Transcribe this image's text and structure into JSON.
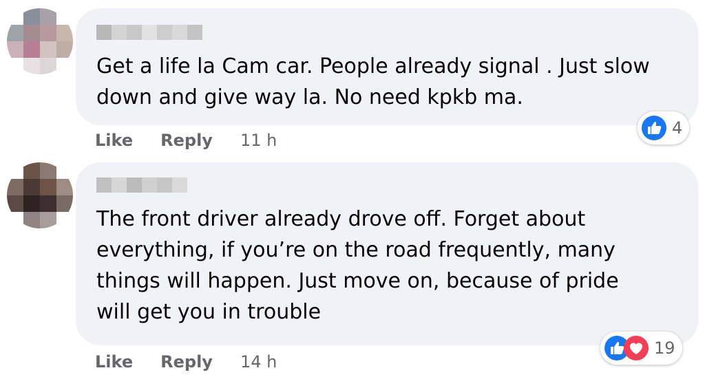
{
  "comments": [
    {
      "text": "Get a life la Cam car. People already signal . Just slow\ndown and give way la. No need kpkb ma.",
      "actions": {
        "like": "Like",
        "reply": "Reply",
        "time": "11 h"
      },
      "reactions": {
        "icons": [
          "like-icon"
        ],
        "count": "4"
      }
    },
    {
      "text": "The front driver already drove off. Forget about\neverything, if you’re on the road frequently, many\nthings will happen. Just move on, because of pride\nwill get you in trouble",
      "actions": {
        "like": "Like",
        "reply": "Reply",
        "time": "14 h"
      },
      "reactions": {
        "icons": [
          "like-icon",
          "love-icon"
        ],
        "count": "19"
      }
    }
  ],
  "colors": {
    "bubble": "#f0f2f5",
    "like_blue": "#1877f2",
    "love_red": "#f33e58",
    "meta_gray": "#65676b"
  }
}
